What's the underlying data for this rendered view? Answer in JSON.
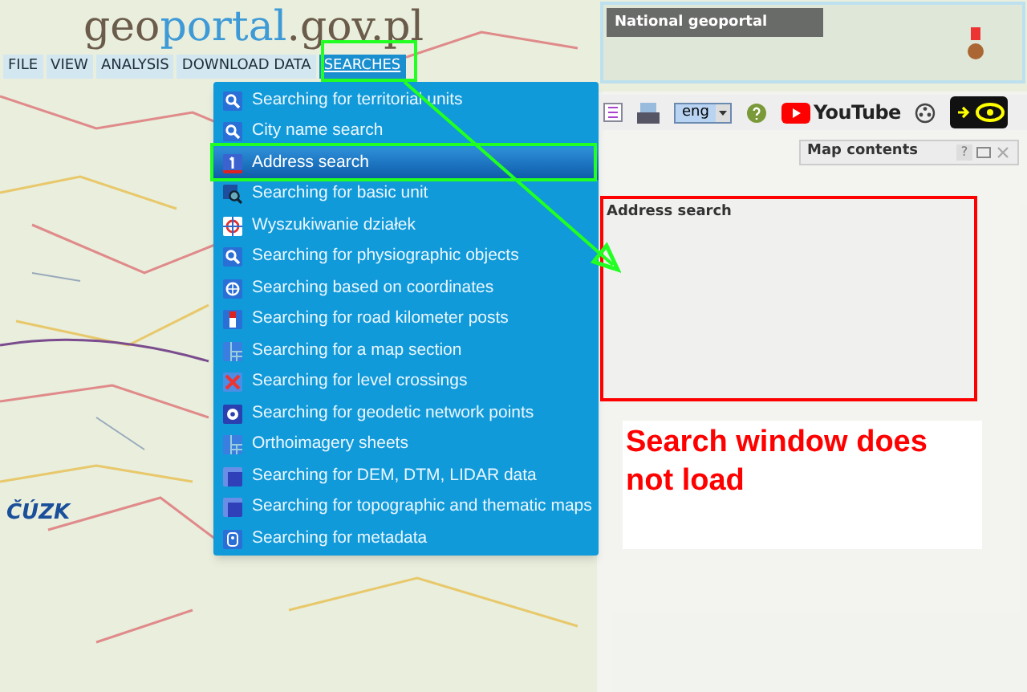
{
  "logo": {
    "parts": [
      {
        "text": "geo",
        "kind": "dark"
      },
      {
        "text": "portal",
        "kind": "blue"
      },
      {
        "text": ".gov.pl",
        "kind": "dark"
      }
    ]
  },
  "menu": [
    {
      "label": "FILE",
      "selected": false
    },
    {
      "label": "VIEW",
      "selected": false
    },
    {
      "label": "ANALYSIS",
      "selected": false
    },
    {
      "label": "DOWNLOAD DATA",
      "selected": false
    },
    {
      "label": "SEARCHES",
      "selected": true
    }
  ],
  "search_menu": [
    {
      "label": "Searching for territorial units",
      "kind": "magnifier",
      "selected": false
    },
    {
      "label": "City name search",
      "kind": "magnifier",
      "selected": false
    },
    {
      "label": "Address search",
      "kind": "number",
      "selected": true
    },
    {
      "label": "Searching for basic unit",
      "kind": "zoom",
      "selected": false
    },
    {
      "label": "Wyszukiwanie działek",
      "kind": "target",
      "selected": false
    },
    {
      "label": "Searching for physiographic objects",
      "kind": "magnifier",
      "selected": false
    },
    {
      "label": "Searching based on coordinates",
      "kind": "globe",
      "selected": false
    },
    {
      "label": "Searching for road kilometer posts",
      "kind": "post",
      "selected": false
    },
    {
      "label": "Searching for a map section",
      "kind": "grid",
      "selected": false
    },
    {
      "label": "Searching for level crossings",
      "kind": "cross",
      "selected": false
    },
    {
      "label": "Searching for geodetic network points",
      "kind": "point",
      "selected": false
    },
    {
      "label": "Orthoimagery sheets",
      "kind": "grid",
      "selected": false
    },
    {
      "label": "Searching for DEM, DTM, LIDAR data",
      "kind": "layers",
      "selected": false
    },
    {
      "label": "Searching for topographic and thematic maps",
      "kind": "layers",
      "selected": false
    },
    {
      "label": "Searching for metadata",
      "kind": "doc",
      "selected": false
    }
  ],
  "overview_map": {
    "title": "National geoportal"
  },
  "toolbar": {
    "language": "eng",
    "video_label": "YouTube"
  },
  "map_contents": {
    "title": "Map contents",
    "help": "?"
  },
  "address_search": {
    "title": "Address search"
  },
  "agency_logo": {
    "text": "ČÚZK"
  },
  "annotation": {
    "text": "Search window does not load"
  }
}
